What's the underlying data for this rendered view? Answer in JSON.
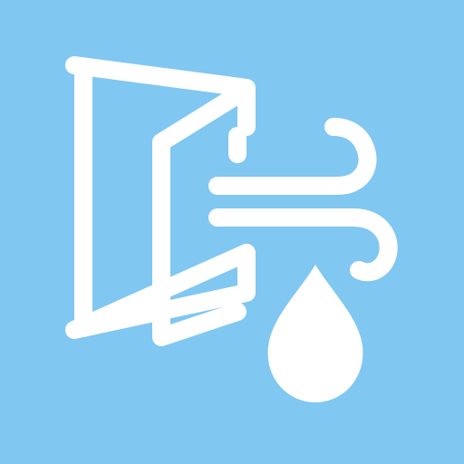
{
  "icon": {
    "symbols": [
      "open-door-icon",
      "wind-icon",
      "water-drop-icon"
    ]
  },
  "colors": {
    "background": "#80c7f2",
    "glyph": "#ffffff"
  }
}
